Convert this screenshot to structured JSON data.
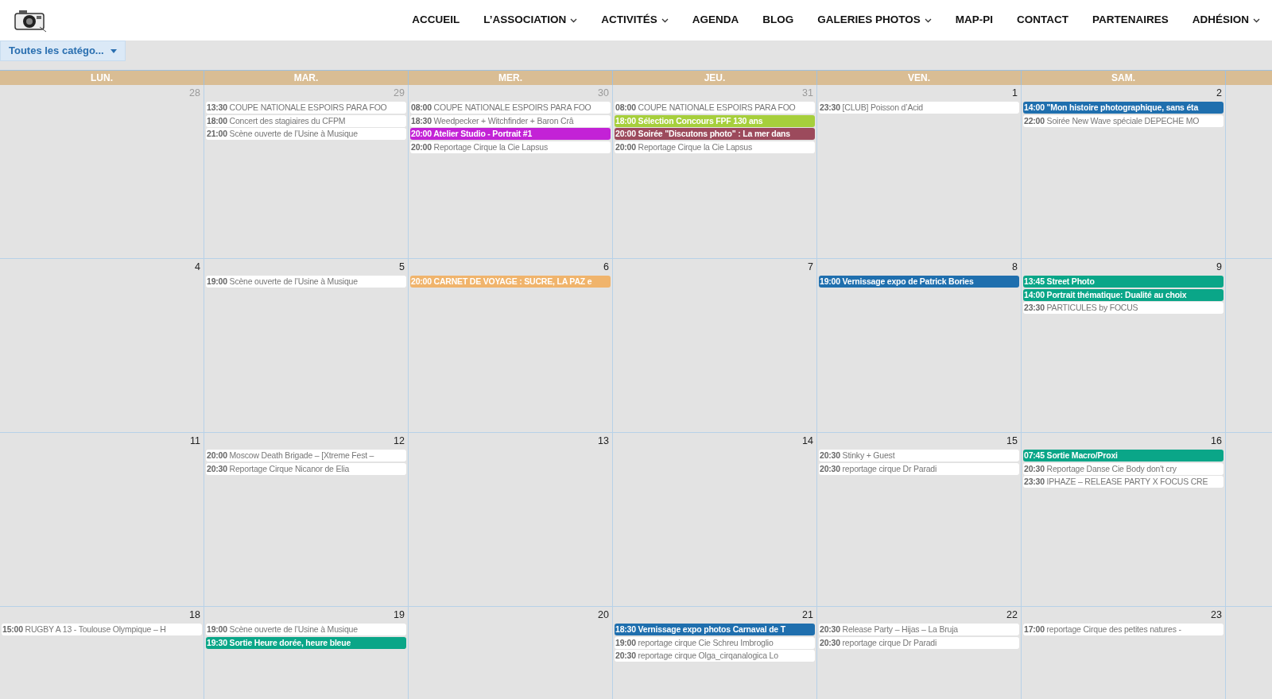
{
  "nav": {
    "items": [
      {
        "label": "ACCUEIL",
        "has_menu": false
      },
      {
        "label": "L’ASSOCIATION",
        "has_menu": true
      },
      {
        "label": "ACTIVITÉS",
        "has_menu": true
      },
      {
        "label": "AGENDA",
        "has_menu": false
      },
      {
        "label": "BLOG",
        "has_menu": false
      },
      {
        "label": "GALERIES PHOTOS",
        "has_menu": true
      },
      {
        "label": "MAP-PI",
        "has_menu": false
      },
      {
        "label": "CONTACT",
        "has_menu": false
      },
      {
        "label": "PARTENAIRES",
        "has_menu": false
      },
      {
        "label": "ADHÉSION",
        "has_menu": true
      }
    ]
  },
  "filter": {
    "value": "Toutes les catégo..."
  },
  "calendar": {
    "weekdays": [
      "LUN.",
      "MAR.",
      "MER.",
      "JEU.",
      "VEN.",
      "SAM."
    ],
    "weeks": [
      {
        "days": [
          {
            "number": "28",
            "other_month": true
          },
          {
            "number": "29",
            "other_month": true,
            "events": [
              {
                "time": "13:30",
                "title": "COUPE NATIONALE ESPOIRS PARA FOO",
                "kind": "plain",
                "color": "#ffffff"
              },
              {
                "time": "18:00",
                "title": "Concert des stagiaires du CFPM",
                "kind": "plain",
                "color": "#ffffff"
              },
              {
                "time": "21:00",
                "title": "Scène ouverte de l’Usine à Musique",
                "kind": "plain",
                "color": "#ffffff"
              }
            ]
          },
          {
            "number": "30",
            "other_month": true,
            "events": [
              {
                "time": "08:00",
                "title": "COUPE NATIONALE ESPOIRS PARA FOO",
                "kind": "plain",
                "color": "#ffffff"
              },
              {
                "time": "18:30",
                "title": "Weedpecker + Witchfinder + Baron Crâ",
                "kind": "plain",
                "color": "#ffffff"
              },
              {
                "time": "20:00",
                "title": "Atelier Studio - Portrait #1",
                "kind": "highlight",
                "color": "#c322d6"
              },
              {
                "time": "20:00",
                "title": "Reportage Cirque la Cie Lapsus",
                "kind": "plain",
                "color": "#ffffff"
              }
            ]
          },
          {
            "number": "31",
            "other_month": true,
            "events": [
              {
                "time": "08:00",
                "title": "COUPE NATIONALE ESPOIRS PARA FOO",
                "kind": "plain",
                "color": "#ffffff"
              },
              {
                "time": "18:00",
                "title": "Sélection Concours FPF 130 ans",
                "kind": "highlight",
                "color": "#a6cf3c"
              },
              {
                "time": "20:00",
                "title": "Soirée \"Discutons photo\" : La mer dans",
                "kind": "highlight",
                "color": "#9c4a5c"
              },
              {
                "time": "20:00",
                "title": "Reportage Cirque la Cie Lapsus",
                "kind": "plain",
                "color": "#ffffff"
              }
            ]
          },
          {
            "number": "1",
            "other_month": false,
            "events": [
              {
                "time": "23:30",
                "title": "[CLUB] Poisson d’Acid",
                "kind": "plain",
                "color": "#ffffff"
              }
            ]
          },
          {
            "number": "2",
            "other_month": false,
            "events": [
              {
                "time": "14:00",
                "title": "\"Mon histoire photographique, sans éta",
                "kind": "highlight",
                "color": "#1f6fae"
              },
              {
                "time": "22:00",
                "title": "Soirée New Wave spéciale DEPECHE MO",
                "kind": "plain",
                "color": "#ffffff"
              }
            ]
          }
        ]
      },
      {
        "days": [
          {
            "number": "4",
            "other_month": false
          },
          {
            "number": "5",
            "other_month": false,
            "events": [
              {
                "time": "19:00",
                "title": "Scène ouverte de l’Usine à Musique",
                "kind": "plain",
                "color": "#ffffff"
              }
            ]
          },
          {
            "number": "6",
            "other_month": false,
            "events": [
              {
                "time": "20:00",
                "title": "CARNET DE VOYAGE : SUCRE, LA PAZ e",
                "kind": "highlight",
                "color": "#f0b46c"
              }
            ]
          },
          {
            "number": "7",
            "other_month": false
          },
          {
            "number": "8",
            "other_month": false,
            "events": [
              {
                "time": "19:00",
                "title": "Vernissage expo de Patrick Bories",
                "kind": "highlight",
                "color": "#1f6fae"
              }
            ]
          },
          {
            "number": "9",
            "other_month": false,
            "events": [
              {
                "time": "13:45",
                "title": "Street Photo",
                "kind": "highlight",
                "color": "#0aa688"
              },
              {
                "time": "14:00",
                "title": "Portrait thématique: Dualité au choix",
                "kind": "highlight",
                "color": "#0aa688"
              },
              {
                "time": "23:30",
                "title": "PARTICULES by FOCUS",
                "kind": "plain",
                "color": "#ffffff"
              }
            ]
          }
        ]
      },
      {
        "days": [
          {
            "number": "11",
            "other_month": false
          },
          {
            "number": "12",
            "other_month": false,
            "events": [
              {
                "time": "20:00",
                "title": "Moscow Death Brigade – [Xtreme Fest –",
                "kind": "plain",
                "color": "#ffffff"
              },
              {
                "time": "20:30",
                "title": "Reportage Cirque Nicanor de Elia",
                "kind": "plain",
                "color": "#ffffff"
              }
            ]
          },
          {
            "number": "13",
            "other_month": false
          },
          {
            "number": "14",
            "other_month": false
          },
          {
            "number": "15",
            "other_month": false,
            "events": [
              {
                "time": "20:30",
                "title": "Stinky + Guest",
                "kind": "plain",
                "color": "#ffffff"
              },
              {
                "time": "20:30",
                "title": "reportage cirque Dr Paradi",
                "kind": "plain",
                "color": "#ffffff"
              }
            ]
          },
          {
            "number": "16",
            "other_month": false,
            "events": [
              {
                "time": "07:45",
                "title": "Sortie Macro/Proxi",
                "kind": "highlight",
                "color": "#0aa688"
              },
              {
                "time": "20:30",
                "title": "Reportage Danse Cie Body don't cry",
                "kind": "plain",
                "color": "#ffffff"
              },
              {
                "time": "23:30",
                "title": "IPHAZE – RELEASE PARTY X FOCUS CRE",
                "kind": "plain",
                "color": "#ffffff"
              }
            ]
          }
        ]
      },
      {
        "days": [
          {
            "number": "18",
            "other_month": false,
            "events": [
              {
                "time": "15:00",
                "title": "RUGBY A 13 - Toulouse Olympique – H",
                "kind": "plain",
                "color": "#ffffff"
              }
            ]
          },
          {
            "number": "19",
            "other_month": false,
            "events": [
              {
                "time": "19:00",
                "title": "Scène ouverte de l’Usine à Musique",
                "kind": "plain",
                "color": "#ffffff"
              },
              {
                "time": "19:30",
                "title": "Sortie Heure dorée, heure bleue",
                "kind": "highlight",
                "color": "#0aa688"
              }
            ]
          },
          {
            "number": "20",
            "other_month": false
          },
          {
            "number": "21",
            "other_month": false,
            "events": [
              {
                "time": "18:30",
                "title": "Vernissage expo photos Carnaval de T",
                "kind": "highlight",
                "color": "#1f6fae"
              },
              {
                "time": "19:00",
                "title": "reportage cirque Cie Schreu Imbroglio",
                "kind": "plain",
                "color": "#ffffff"
              },
              {
                "time": "20:30",
                "title": "reportage cirque Olga_cirqanalogica Lo",
                "kind": "plain",
                "color": "#ffffff"
              }
            ]
          },
          {
            "number": "22",
            "other_month": false,
            "events": [
              {
                "time": "20:30",
                "title": "Release Party – Hijas – La Bruja",
                "kind": "plain",
                "color": "#ffffff"
              },
              {
                "time": "20:30",
                "title": "reportage cirque Dr Paradi",
                "kind": "plain",
                "color": "#ffffff"
              }
            ]
          },
          {
            "number": "23",
            "other_month": false,
            "events": [
              {
                "time": "17:00",
                "title": "reportage Cirque des petites natures -",
                "kind": "plain",
                "color": "#ffffff"
              }
            ]
          }
        ]
      }
    ]
  }
}
